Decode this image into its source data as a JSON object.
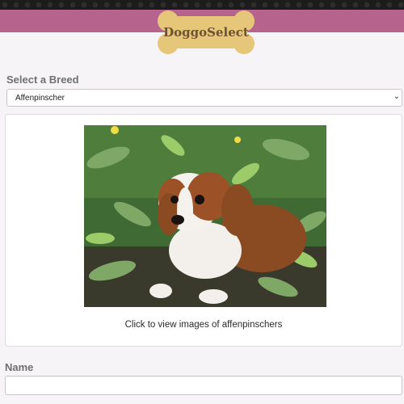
{
  "header": {
    "brand_name": "DoggoSelect",
    "bar_color": "#b6648e",
    "bone_color": "#e6c77a",
    "icon": "bone-logo"
  },
  "breed_select": {
    "label": "Select a Breed",
    "selected_value": "Affenpinscher",
    "icon": "chevron-down-icon"
  },
  "image_card": {
    "photo_subject": "puppy-photo",
    "caption": "Click to view images of affenpinschers"
  },
  "name_field": {
    "label": "Name",
    "value": ""
  }
}
